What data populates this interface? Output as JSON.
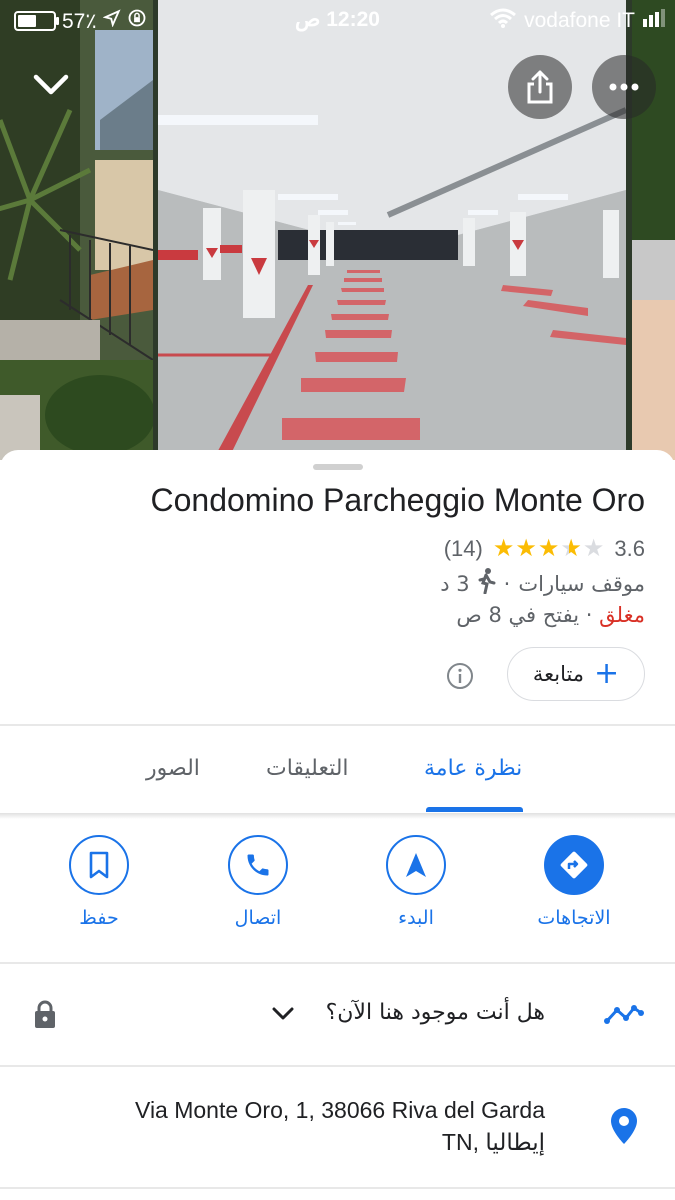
{
  "status_bar": {
    "battery": "57٪",
    "battery_level": 0.57,
    "time": "12:20 ص",
    "carrier": "vodafone IT"
  },
  "header": {
    "collapse_icon": "chevron-down-icon",
    "share_icon": "share-icon",
    "more_icon": "more-horizontal-icon"
  },
  "place": {
    "name": "Condomino Parcheggio Monte Oro",
    "rating": "3.6",
    "rating_value": 3.6,
    "review_count": "(14)",
    "category": "موقف سيارات",
    "separator": "·",
    "walk_time": "3 د",
    "status_closed": "مغلق",
    "opens": "· يفتح في 8 ص",
    "follow_label": "متابعة"
  },
  "tabs": [
    {
      "label": "نظرة عامة",
      "active": true
    },
    {
      "label": "التعليقات",
      "active": false
    },
    {
      "label": "الصور",
      "active": false
    }
  ],
  "actions": [
    {
      "label": "الاتجاهات",
      "icon": "directions-icon"
    },
    {
      "label": "البدء",
      "icon": "navigation-icon"
    },
    {
      "label": "اتصال",
      "icon": "phone-icon"
    },
    {
      "label": "حفظ",
      "icon": "bookmark-icon"
    }
  ],
  "question": {
    "text": "هل أنت موجود هنا الآن؟"
  },
  "address": {
    "line1": "Via Monte Oro, 1, 38066 Riva del Garda",
    "line2": "TN, إيطاليا"
  },
  "colors": {
    "accent": "#1a73e8",
    "star": "#fbbc04",
    "closed": "#d93025"
  }
}
